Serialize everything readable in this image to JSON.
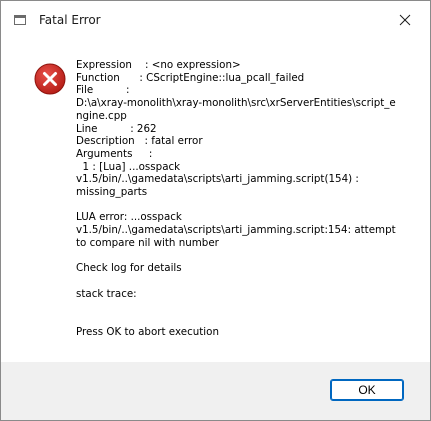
{
  "window": {
    "title": "Fatal Error",
    "close_icon": "close-icon",
    "app_icon": "window-app-icon"
  },
  "message": {
    "icon": "error-icon",
    "lines": [
      "Expression    : <no expression>",
      "Function      : CScriptEngine::lua_pcall_failed",
      "File          :",
      "D:\\a\\xray-monolith\\xray-monolith\\src\\xrServerEntities\\script_e",
      "ngine.cpp",
      "Line          : 262",
      "Description   : fatal error",
      "Arguments     :",
      "  1 : [Lua] ...osspack",
      "v1.5/bin/..\\gamedata\\scripts\\arti_jamming.script(154) :",
      "missing_parts",
      "",
      "LUA error: ...osspack",
      "v1.5/bin/..\\gamedata\\scripts\\arti_jamming.script:154: attempt",
      "to compare nil with number",
      "",
      "Check log for details",
      "",
      "stack trace:",
      "",
      "",
      "Press OK to abort execution"
    ]
  },
  "footer": {
    "ok_label": "OK"
  },
  "colors": {
    "error_red": "#c42b1c",
    "accent_blue": "#0067c0",
    "footer_bg": "#f0f0f0"
  }
}
